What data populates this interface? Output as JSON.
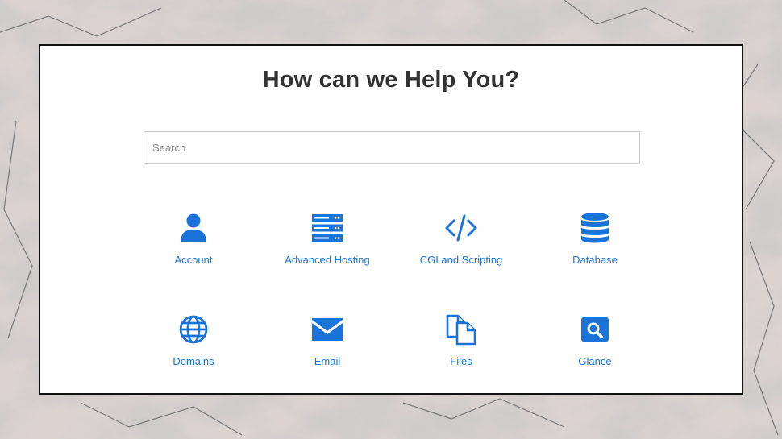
{
  "page": {
    "title": "How can we Help You?"
  },
  "search": {
    "placeholder": "Search",
    "value": ""
  },
  "categories": [
    {
      "label": "Account",
      "icon": "user-icon"
    },
    {
      "label": "Advanced Hosting",
      "icon": "server-icon"
    },
    {
      "label": "CGI and Scripting",
      "icon": "code-icon"
    },
    {
      "label": "Database",
      "icon": "database-icon"
    },
    {
      "label": "Domains",
      "icon": "globe-icon"
    },
    {
      "label": "Email",
      "icon": "envelope-icon"
    },
    {
      "label": "Files",
      "icon": "files-icon"
    },
    {
      "label": "Glance",
      "icon": "search-icon"
    }
  ],
  "colors": {
    "accent": "#1a73d9",
    "title": "#333333",
    "panel_border": "#111111"
  }
}
